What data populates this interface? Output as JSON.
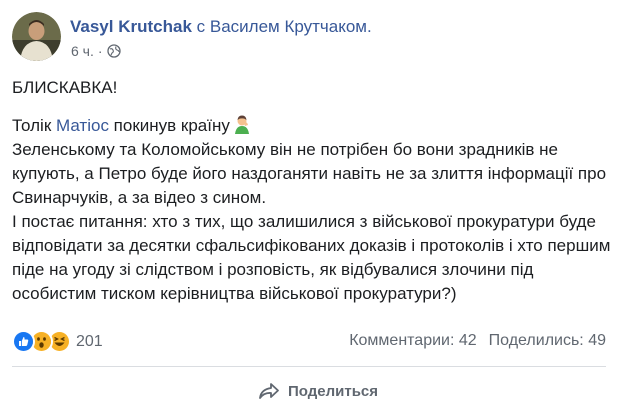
{
  "post": {
    "author": "Vasyl Krutchak",
    "with_text": "с Василем Крутчаком.",
    "time": "6 ч.",
    "dot": "·",
    "headline": "БЛИСКАВКА!",
    "line1_prefix": "Толік ",
    "line1_mention": "Матіос",
    "line1_suffix": " покинув країну",
    "paragraph1": "Зеленському та Коломойському він не потрібен бо вони зрадників не купують, а Петро буде його наздоганяти навіть не за злиття інформації про Свинарчуків, а за відео з сином.",
    "paragraph2": "І постає питання: хто з тих, що залишилися з військової прокуратури буде відповідати за десятки сфальсифікованих доказів і протоколів і хто першим піде на угоду зі слідством і розповість, як відбувалися злочини під особистим тиском керівництва військової прокуратури?)"
  },
  "footer": {
    "reactions_count": "201",
    "comments": "Комментарии: 42",
    "shares": "Поделились: 49",
    "share_button": "Поделиться"
  },
  "colors": {
    "link": "#385898",
    "secondary_text": "#606770",
    "like_blue": "#1877f2",
    "wow_yellow": "#f7b125"
  },
  "icons": [
    "avatar",
    "globe-icon",
    "facepalm-emoji",
    "like-reaction-icon",
    "wow-reaction-icon",
    "haha-reaction-icon",
    "share-arrow-icon"
  ]
}
